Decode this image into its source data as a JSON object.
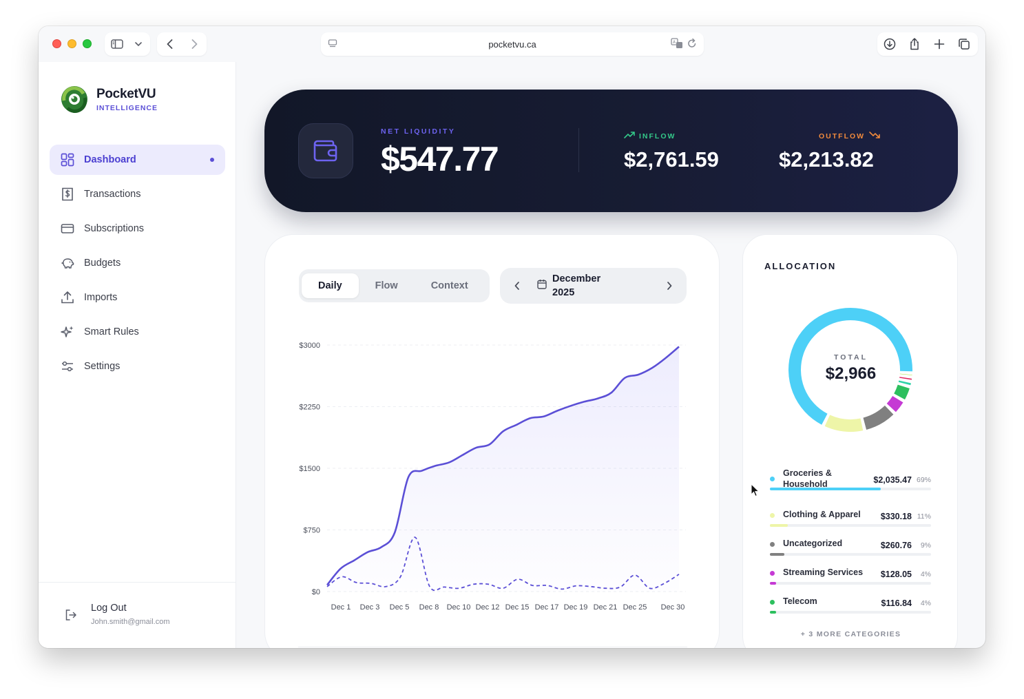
{
  "browser": {
    "url": "pocketvu.ca"
  },
  "app": {
    "name": "PocketVU",
    "tagline": "INTELLIGENCE"
  },
  "sidebar": {
    "items": [
      {
        "label": "Dashboard",
        "icon": "dashboard-grid-icon",
        "active": true
      },
      {
        "label": "Transactions",
        "icon": "receipt-dollar-icon"
      },
      {
        "label": "Subscriptions",
        "icon": "credit-card-icon"
      },
      {
        "label": "Budgets",
        "icon": "piggy-bank-icon"
      },
      {
        "label": "Imports",
        "icon": "upload-icon"
      },
      {
        "label": "Smart Rules",
        "icon": "sparkles-icon"
      },
      {
        "label": "Settings",
        "icon": "sliders-icon"
      }
    ],
    "logout_label": "Log Out",
    "user_email": "John.smith@gmail.com"
  },
  "summary": {
    "net_label": "NET LIQUIDITY",
    "net_value": "$547.77",
    "inflow_label": "INFLOW",
    "inflow_value": "$2,761.59",
    "outflow_label": "OUTFLOW",
    "outflow_value": "$2,213.82",
    "colors": {
      "inflow": "#34c98a",
      "outflow": "#f08a3c",
      "accent": "#6d63f0"
    }
  },
  "chart_controls": {
    "tabs": [
      "Daily",
      "Flow",
      "Context"
    ],
    "active_tab": "Daily",
    "month_line1": "December",
    "month_line2": "2025"
  },
  "chart_data": {
    "type": "line",
    "x_ticks": [
      "Dec 1",
      "Dec 3",
      "Dec 5",
      "Dec 8",
      "Dec 10",
      "Dec 12",
      "Dec 15",
      "Dec 17",
      "Dec 19",
      "Dec 21",
      "Dec 25",
      "Dec 30"
    ],
    "y_ticks": [
      "$0",
      "$750",
      "$1500",
      "$2250",
      "$3000"
    ],
    "ylim": [
      0,
      3000
    ],
    "x": [
      1,
      2,
      3,
      4,
      5,
      6,
      7,
      8,
      9,
      10,
      11,
      12,
      13,
      14,
      15,
      16,
      17,
      18,
      19,
      20,
      21,
      22,
      23,
      24,
      25,
      26,
      27,
      28,
      29,
      30
    ],
    "series": [
      {
        "style": "solid-area",
        "color": "#5b4fd6",
        "values": [
          80,
          280,
          380,
          480,
          540,
          720,
          1390,
          1470,
          1530,
          1570,
          1660,
          1750,
          1790,
          1950,
          2030,
          2110,
          2130,
          2200,
          2260,
          2310,
          2350,
          2420,
          2600,
          2640,
          2720,
          2840,
          2980
        ]
      },
      {
        "style": "dashed",
        "color": "#5b4fd6",
        "values": [
          60,
          180,
          110,
          100,
          60,
          180,
          660,
          60,
          55,
          40,
          90,
          90,
          40,
          150,
          75,
          75,
          30,
          70,
          60,
          40,
          55,
          200,
          40,
          100,
          210
        ]
      }
    ]
  },
  "allocation": {
    "title": "ALLOCATION",
    "total_label": "TOTAL",
    "total_value": "$2,966",
    "categories": [
      {
        "name_line1": "Groceries &",
        "name_line2": "Household",
        "amount": "$2,035.47",
        "pct": "69%",
        "share": 0.69,
        "color": "#4dd0f7"
      },
      {
        "name_line1": "Clothing & Apparel",
        "name_line2": "",
        "amount": "$330.18",
        "pct": "11%",
        "share": 0.11,
        "color": "#eef5a8"
      },
      {
        "name_line1": "Uncategorized",
        "name_line2": "",
        "amount": "$260.76",
        "pct": "9%",
        "share": 0.09,
        "color": "#808080"
      },
      {
        "name_line1": "Streaming Services",
        "name_line2": "",
        "amount": "$128.05",
        "pct": "4%",
        "share": 0.04,
        "color": "#c53ad4"
      },
      {
        "name_line1": "Telecom",
        "name_line2": "",
        "amount": "$116.84",
        "pct": "4%",
        "share": 0.04,
        "color": "#2dbf5e"
      }
    ],
    "more_label": "+ 3 MORE CATEGORIES"
  }
}
